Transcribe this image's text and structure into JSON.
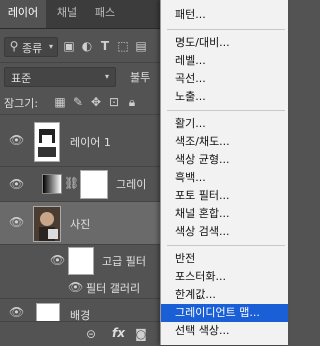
{
  "tabs": [
    {
      "label": "레이어"
    },
    {
      "label": "채널"
    },
    {
      "label": "패스"
    }
  ],
  "filter": {
    "kind_label": "종류"
  },
  "blend": {
    "mode": "표준",
    "opacity_label": "불투"
  },
  "lock": {
    "label": "잠그기:"
  },
  "layers": [
    {
      "name": "레이어 1"
    },
    {
      "name": "그레이"
    },
    {
      "name": "사진"
    },
    {
      "name": "고급 필터"
    },
    {
      "name": "필터 갤러리"
    },
    {
      "name": "배경"
    }
  ],
  "bottom": {
    "fx_label": "fx"
  },
  "menu": {
    "group0": [
      "패턴..."
    ],
    "group1": [
      "명도/대비...",
      "레벨...",
      "곡선...",
      "노출..."
    ],
    "group2": [
      "활기...",
      "색조/채도...",
      "색상 균형...",
      "흑백...",
      "포토 필터...",
      "채널 혼합...",
      "색상 검색..."
    ],
    "group3": [
      "반전",
      "포스터화...",
      "한계값...",
      "그레이디언트 맵...",
      "선택 색상..."
    ]
  },
  "colors": {
    "highlight": "#1a5fd6",
    "accent_green": "#2fe01a",
    "panel_bg": "#535353"
  }
}
